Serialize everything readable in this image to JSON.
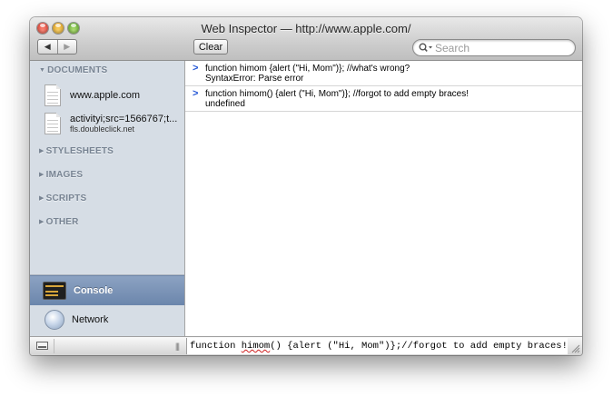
{
  "window": {
    "title": "Web Inspector — http://www.apple.com/"
  },
  "toolbar": {
    "back_icon": "◀",
    "forward_icon": "▶",
    "clear_label": "Clear",
    "search_placeholder": "Search"
  },
  "sidebar": {
    "sections": {
      "documents": "DOCUMENTS",
      "stylesheets": "STYLESHEETS",
      "images": "IMAGES",
      "scripts": "SCRIPTS",
      "other": "OTHER"
    },
    "documents": [
      {
        "name": "www.apple.com",
        "subtitle": ""
      },
      {
        "name": "activityi;src=1566767;t...",
        "subtitle": "fls.doubleclick.net"
      }
    ],
    "panels": [
      {
        "label": "Console",
        "selected": true
      },
      {
        "label": "Network",
        "selected": false
      }
    ]
  },
  "console": {
    "entries": [
      {
        "command": "function himom {alert (\"Hi, Mom\")}; //what's wrong?",
        "result": "SyntaxError: Parse error"
      },
      {
        "command": "function himom() {alert (\"Hi, Mom\")}; //forgot to add empty braces!",
        "result": "undefined"
      }
    ],
    "input": {
      "before": "function ",
      "misspelled": "himom",
      "after": "() {alert (\"Hi, Mom\")};//forgot to add empty braces!"
    }
  },
  "colors": {
    "sidebar_bg": "#d6dde5",
    "selected_panel": "#7a93b7",
    "prompt": "#2457d6"
  }
}
